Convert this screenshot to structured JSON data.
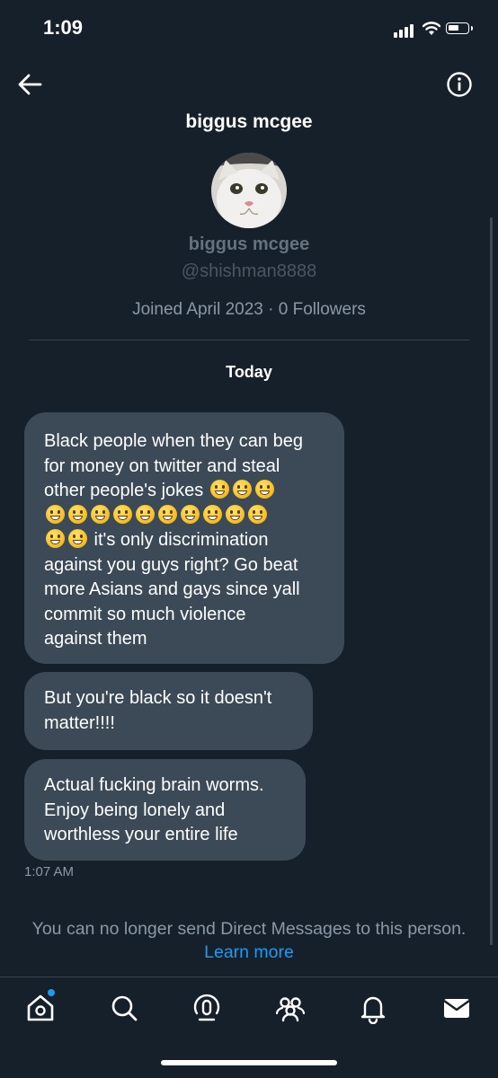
{
  "status_bar": {
    "time": "1:09"
  },
  "header": {
    "title": "biggus mcgee"
  },
  "profile": {
    "name": "biggus mcgee",
    "handle": "@shishman8888",
    "meta": "Joined April 2023 · 0 Followers"
  },
  "conversation": {
    "date_separator": "Today",
    "messages": [
      {
        "lines": [
          "Black people when they can beg",
          "for money on twitter and steal",
          "other people's jokes",
          "",
          " it's only discrimination",
          "against you guys right? Go beat",
          "more Asians and gays since yall",
          "commit so much violence",
          "against them"
        ]
      },
      {
        "lines": [
          "But you're black so it doesn't",
          "matter!!!!"
        ]
      },
      {
        "lines": [
          "Actual fucking brain worms.",
          "Enjoy being lonely and",
          "worthless your entire life"
        ]
      }
    ],
    "timestamp": "1:07 AM"
  },
  "notice": {
    "text": "You can no longer send Direct Messages to this person.",
    "link": "Learn more"
  },
  "icons": {
    "back": "back-arrow-icon",
    "info": "info-icon",
    "nav": [
      "home-icon",
      "search-icon",
      "spaces-icon",
      "communities-icon",
      "notifications-icon",
      "messages-icon"
    ]
  },
  "colors": {
    "background": "#15202b",
    "bubble": "#3c4a57",
    "accent": "#1d9bf0",
    "muted_text": "#8b98a5"
  }
}
